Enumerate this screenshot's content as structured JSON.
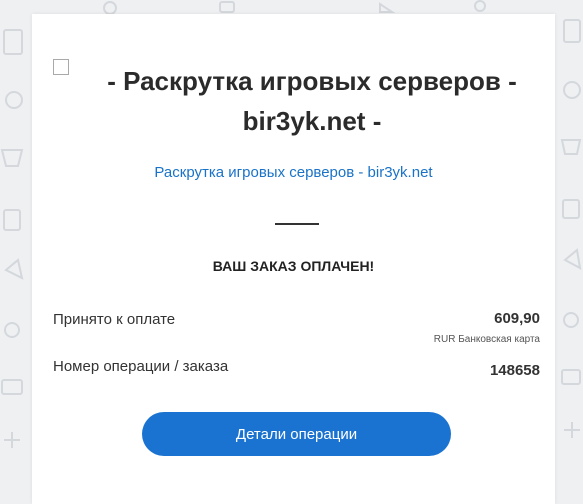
{
  "title": "- Раскрутка игровых серверов - bir3yk.net -",
  "merchant_link": "Раскрутка игровых серверов - bir3yk.net",
  "status": "ВАШ ЗАКАЗ ОПЛАЧЕН!",
  "payment": {
    "label": "Принято к оплате",
    "amount": "609,90",
    "method": "RUR Банковская карта"
  },
  "operation": {
    "label": "Номер операции / заказа",
    "number": "148658"
  },
  "details_button": "Детали операции",
  "colors": {
    "accent": "#1a73d0",
    "link": "#1a73c8",
    "background": "#eef0f2"
  }
}
